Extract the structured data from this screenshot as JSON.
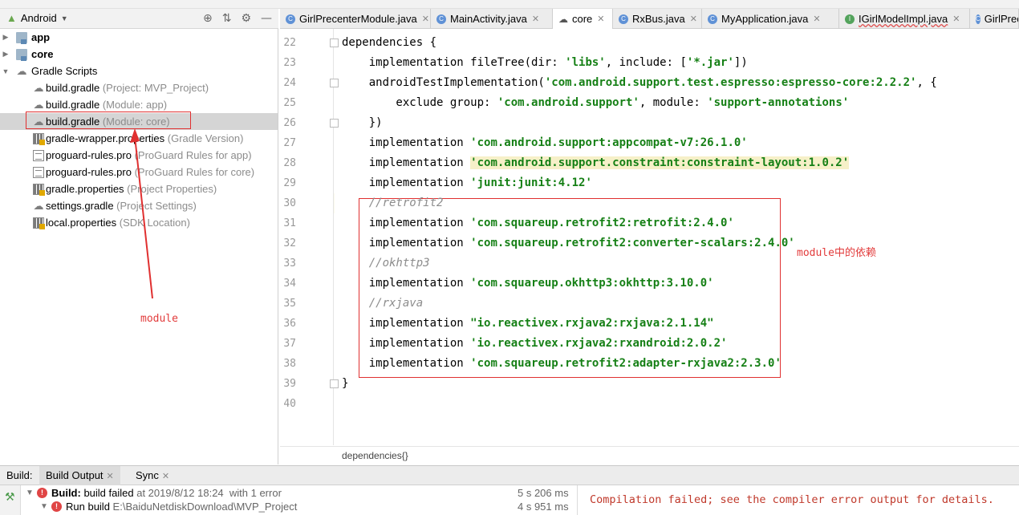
{
  "project_panel": {
    "view": "Android",
    "tree": [
      {
        "name": "app",
        "hint": "",
        "bold": true,
        "icon": "folder-icon",
        "arrow": "▶"
      },
      {
        "name": "core",
        "hint": "",
        "bold": true,
        "icon": "folder-icon",
        "arrow": "▶"
      },
      {
        "name": "Gradle Scripts",
        "hint": "",
        "bold": false,
        "icon": "gradle-icon",
        "arrow": "▼"
      },
      {
        "name": "build.gradle",
        "hint": "(Project: MVP_Project)",
        "icon": "gradle-icon"
      },
      {
        "name": "build.gradle",
        "hint": "(Module: app)",
        "icon": "gradle-icon"
      },
      {
        "name": "build.gradle",
        "hint": "(Module: core)",
        "icon": "gradle-icon",
        "selected": true
      },
      {
        "name": "gradle-wrapper.properties",
        "hint": "(Gradle Version)",
        "icon": "properties-icon"
      },
      {
        "name": "proguard-rules.pro",
        "hint": "(ProGuard Rules for app)",
        "icon": "file-icon"
      },
      {
        "name": "proguard-rules.pro",
        "hint": "(ProGuard Rules for core)",
        "icon": "file-icon"
      },
      {
        "name": "gradle.properties",
        "hint": "(Project Properties)",
        "icon": "properties-icon"
      },
      {
        "name": "settings.gradle",
        "hint": "(Project Settings)",
        "icon": "gradle-icon"
      },
      {
        "name": "local.properties",
        "hint": "(SDK Location)",
        "icon": "properties-icon"
      }
    ]
  },
  "editor": {
    "tabs": [
      {
        "label": "GirlPrecenterModule.java",
        "icon": "class-icon",
        "active": false
      },
      {
        "label": "MainActivity.java",
        "icon": "class-icon",
        "active": false
      },
      {
        "label": "core",
        "icon": "gradle-icon",
        "active": true
      },
      {
        "label": "RxBus.java",
        "icon": "class-icon",
        "active": false
      },
      {
        "label": "MyApplication.java",
        "icon": "class-icon",
        "active": false
      },
      {
        "label": "IGirlModelImpl.java",
        "icon": "interface-icon",
        "active": false
      },
      {
        "label": "GirlPrec",
        "icon": "class-icon",
        "active": false
      }
    ],
    "first_line_number": 22,
    "lines": [
      [
        {
          "t": "dependencies {",
          "c": "kw"
        }
      ],
      [
        {
          "t": "    implementation fileTree(dir: ",
          "c": "kw"
        },
        {
          "t": "'libs'",
          "c": "str"
        },
        {
          "t": ", include: [",
          "c": "kw"
        },
        {
          "t": "'*.jar'",
          "c": "str"
        },
        {
          "t": "])",
          "c": "kw"
        }
      ],
      [
        {
          "t": "    androidTestImplementation(",
          "c": "kw"
        },
        {
          "t": "'com.android.support.test.espresso:espresso-core:2.2.2'",
          "c": "str"
        },
        {
          "t": ", {",
          "c": "kw"
        }
      ],
      [
        {
          "t": "        exclude group: ",
          "c": "kw"
        },
        {
          "t": "'com.android.support'",
          "c": "str"
        },
        {
          "t": ", module: ",
          "c": "kw"
        },
        {
          "t": "'support-annotations'",
          "c": "str"
        }
      ],
      [
        {
          "t": "    })",
          "c": "kw"
        }
      ],
      [
        {
          "t": "    implementation ",
          "c": "kw"
        },
        {
          "t": "'com.android.support:appcompat-v7:26.1.0'",
          "c": "str"
        }
      ],
      [
        {
          "t": "    implementation ",
          "c": "kw"
        },
        {
          "t": "'com.android.support.constraint:constraint-layout:1.0.2'",
          "c": "str hlstr"
        }
      ],
      [
        {
          "t": "    implementation ",
          "c": "kw"
        },
        {
          "t": "'junit:junit:4.12'",
          "c": "str"
        }
      ],
      [
        {
          "t": "    //retrofit2",
          "c": "cm"
        }
      ],
      [
        {
          "t": "    implementation ",
          "c": "kw"
        },
        {
          "t": "'com.squareup.retrofit2:retrofit:2.4.0'",
          "c": "str"
        }
      ],
      [
        {
          "t": "    implementation ",
          "c": "kw"
        },
        {
          "t": "'com.squareup.retrofit2:converter-scalars:2.4.0'",
          "c": "str"
        }
      ],
      [
        {
          "t": "    //okhttp3",
          "c": "cm"
        }
      ],
      [
        {
          "t": "    implementation ",
          "c": "kw"
        },
        {
          "t": "'com.squareup.okhttp3:okhttp:3.10.0'",
          "c": "str"
        }
      ],
      [
        {
          "t": "    //rxjava",
          "c": "cm"
        }
      ],
      [
        {
          "t": "    implementation ",
          "c": "kw"
        },
        {
          "t": "\"io.reactivex.rxjava2:rxjava:2.1.14\"",
          "c": "str"
        }
      ],
      [
        {
          "t": "    implementation ",
          "c": "kw"
        },
        {
          "t": "'io.reactivex.rxjava2:rxandroid:2.0.2'",
          "c": "str"
        }
      ],
      [
        {
          "t": "    implementation ",
          "c": "kw"
        },
        {
          "t": "'com.squareup.retrofit2:adapter-rxjava2:2.3.0'",
          "c": "str"
        }
      ],
      [
        {
          "t": "}",
          "c": "kw"
        }
      ],
      []
    ],
    "breadcrumb": "dependencies{}",
    "annotations": {
      "dependency_note": "module中的依赖",
      "module_note": "module"
    }
  },
  "build_panel": {
    "label": "Build:",
    "tabs": [
      "Build Output",
      "Sync"
    ],
    "rows": [
      {
        "prefix": "Build:",
        "text": " build failed ",
        "detail": "at 2019/8/12 18:24  with 1 error",
        "time": "5 s 206 ms"
      },
      {
        "prefix": "",
        "text": "Run build ",
        "detail": "E:\\BaiduNetdiskDownload\\MVP_Project",
        "time": "4 s 951 ms"
      }
    ],
    "console_message": "Compilation failed; see the compiler error output for details."
  },
  "colors": {
    "string": "#168016",
    "comment": "#8c8c8c",
    "annotation": "#e23b3b",
    "error": "#e04545"
  }
}
